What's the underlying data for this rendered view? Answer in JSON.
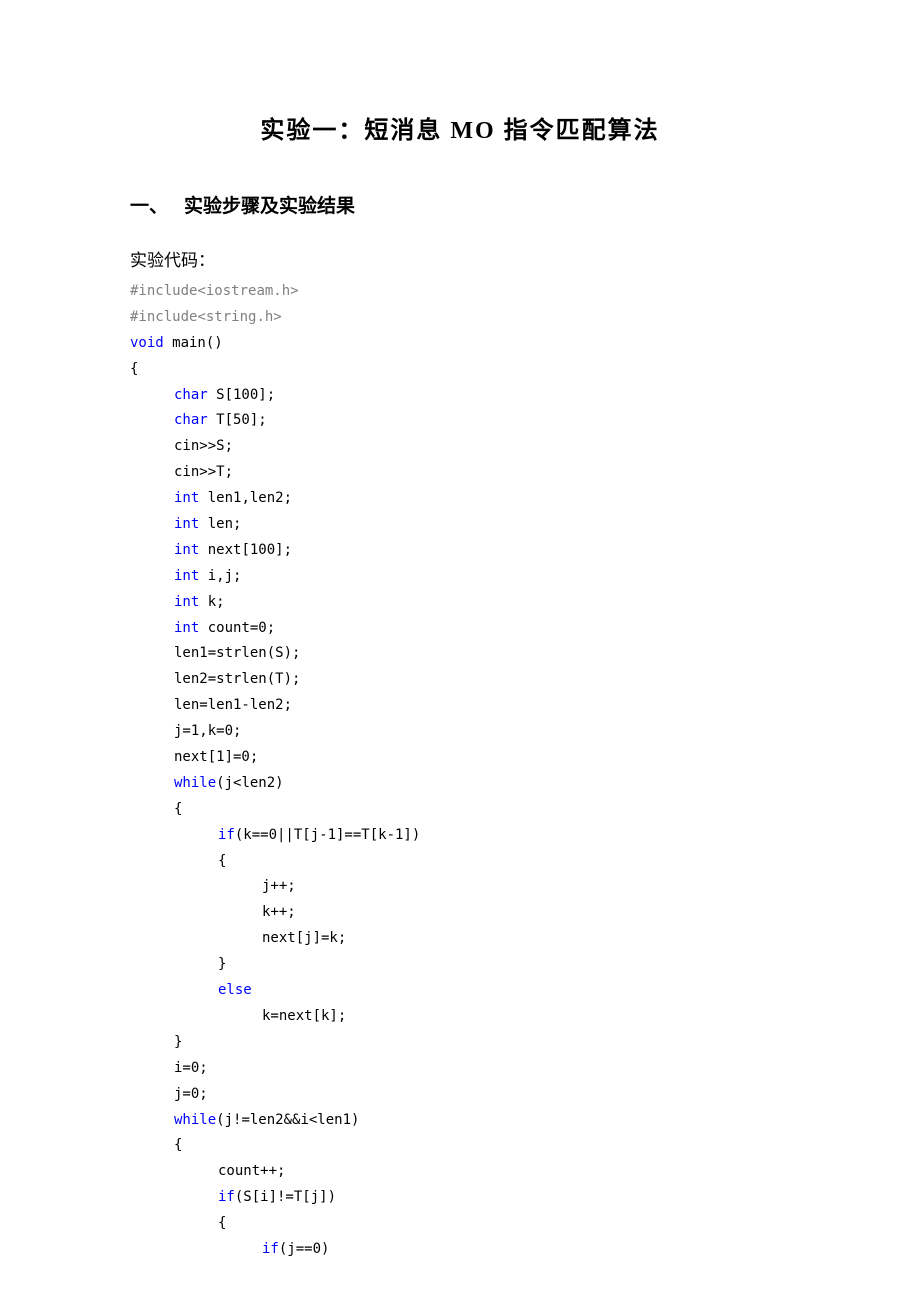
{
  "title": "实验一：短消息 MO 指令匹配算法",
  "section_number": "一、",
  "section_title": "实验步骤及实验结果",
  "sub_heading": "实验代码：",
  "code": {
    "l1a": "#include",
    "l1b": "<iostream.h>",
    "l2a": "#include",
    "l2b": "<string.h>",
    "l3a": "void",
    "l3b": " main()",
    "l4": "{",
    "l5a": "char",
    "l5b": " S[100];",
    "l6a": "char",
    "l6b": " T[50];",
    "l7": "cin>>S;",
    "l8": "cin>>T;",
    "l9a": "int",
    "l9b": " len1,len2;",
    "l10a": "int",
    "l10b": " len;",
    "l11a": "int",
    "l11b": " next[100];",
    "l12a": "int",
    "l12b": " i,j;",
    "l13a": "int",
    "l13b": " k;",
    "l14a": "int",
    "l14b": " count=0;",
    "l15": "len1=strlen(S);",
    "l16": "len2=strlen(T);",
    "l17": "len=len1-len2;",
    "l18": "j=1,k=0;",
    "l19": "next[1]=0;",
    "l20a": "while",
    "l20b": "(j<len2)",
    "l21": "{",
    "l22a": "if",
    "l22b": "(k==0||T[j-1]==T[k-1])",
    "l23": "{",
    "l24": "j++;",
    "l25": "k++;",
    "l26": "next[j]=k;",
    "l27": "}",
    "l28": "else",
    "l29": "k=next[k];",
    "l30": "}",
    "l31": "i=0;",
    "l32": "j=0;",
    "l33a": "while",
    "l33b": "(j!=len2&&i<len1)",
    "l34": "{",
    "l35": "count++;",
    "l36a": "if",
    "l36b": "(S[i]!=T[j])",
    "l37": "{",
    "l38a": "if",
    "l38b": "(j==0)"
  }
}
